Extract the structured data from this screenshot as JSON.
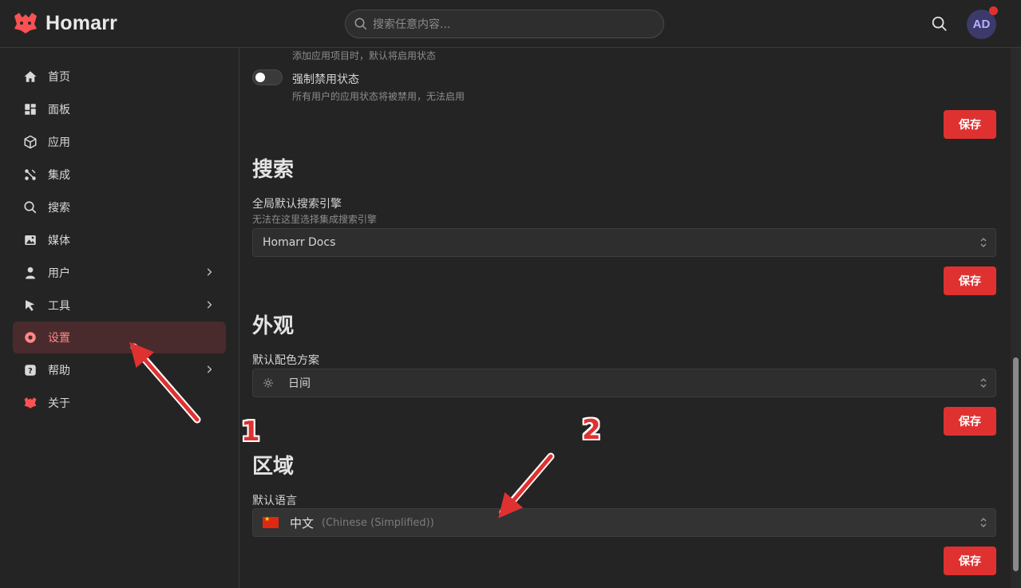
{
  "app": {
    "title": "Homarr"
  },
  "header": {
    "search_placeholder": "搜索任意内容...",
    "avatar_initials": "AD"
  },
  "sidebar": {
    "items": [
      {
        "label": "首页",
        "icon": "home-icon"
      },
      {
        "label": "面板",
        "icon": "dashboard-icon"
      },
      {
        "label": "应用",
        "icon": "box-icon"
      },
      {
        "label": "集成",
        "icon": "plug-icon"
      },
      {
        "label": "搜索",
        "icon": "search-icon"
      },
      {
        "label": "媒体",
        "icon": "photo-icon"
      },
      {
        "label": "用户",
        "icon": "user-icon",
        "has_children": true
      },
      {
        "label": "工具",
        "icon": "pointer-icon",
        "has_children": true
      },
      {
        "label": "设置",
        "icon": "settings-icon",
        "active": true
      },
      {
        "label": "帮助",
        "icon": "help-icon",
        "has_children": true
      },
      {
        "label": "关于",
        "icon": "logo-icon"
      }
    ]
  },
  "apps_section": {
    "enable_status_desc": "添加应用项目时，默认将启用状态",
    "force_disable_label": "强制禁用状态",
    "force_disable_desc": "所有用户的应用状态将被禁用，无法启用",
    "save_label": "保存"
  },
  "search_section": {
    "title": "搜索",
    "engine_label": "全局默认搜索引擎",
    "engine_desc": "无法在这里选择集成搜索引擎",
    "engine_value": "Homarr Docs",
    "save_label": "保存"
  },
  "appearance_section": {
    "title": "外观",
    "scheme_label": "默认配色方案",
    "scheme_value": "日间",
    "save_label": "保存"
  },
  "region_section": {
    "title": "区域",
    "language_label": "默认语言",
    "language_value": "中文",
    "language_english": "(Chinese (Simplified))",
    "save_label": "保存"
  },
  "annotations": {
    "marker_1": "1",
    "marker_2": "2"
  },
  "colors": {
    "accent": "#e03131",
    "active_bg": "#4a2b2d",
    "active_text": "#ff8787"
  }
}
